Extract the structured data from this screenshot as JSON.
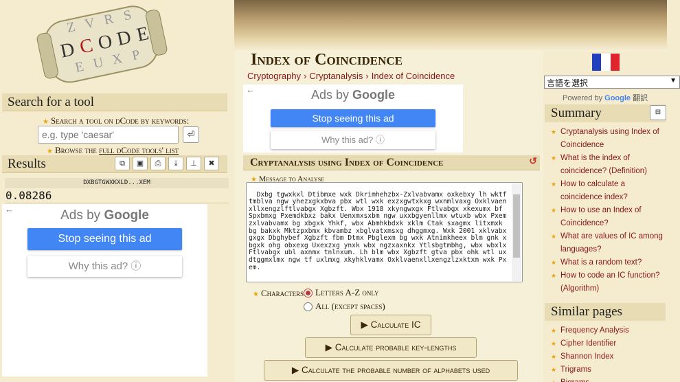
{
  "logo": {
    "letters_top": [
      "Z",
      "V",
      "R",
      "S"
    ],
    "letters_mid": [
      "D",
      "C",
      "O",
      "D",
      "E"
    ],
    "letters_bot": [
      "E",
      "U",
      "X",
      "P"
    ]
  },
  "left": {
    "search_title": "Search for a tool",
    "search_label": "Search a tool on dCode by keywords:",
    "search_placeholder": "e.g. type 'caesar'",
    "browse_prefix": "Browse the ",
    "browse_link": "full dCode tools' list",
    "results_title": "Results",
    "result_key": "DXBGTGWXKXLD...XEM",
    "result_value": "0.08286"
  },
  "ads": {
    "ads_by": "Ads by",
    "google": "Google",
    "stop": "Stop seeing this ad",
    "why": "Why this ad? ⓘ",
    "back": "←"
  },
  "center": {
    "page_title": "Index of Coincidence",
    "breadcrumbs": [
      "Cryptography",
      "Cryptanalysis",
      "Index of Coincidence"
    ],
    "panel_title": "Cryptanalysis using Index of Coincidence",
    "message_label": "Message to Analyse",
    "message_text": "Dxbg tgwxkxl Dtibmxe wxk Dkrimhehzbx-Zxlvabvamx oxkebxy lh wktftmblva ngw yhezxgkxbva pbx wtl wxk exzxgwtxkxg wxnmlvaxg Oxklvaenxllxengzlftlvabgx Xgbzft. Wbx 1918 xkyngwxgx Ftlvabgx xkexumx bf Spxbmxg Pxemdkbxz bakx Uenxmxsxbm ngw uxxbgyenllmx wtuxb wbx Pxemzxlvabvamx bg xbgxk Yhkf, wbx Abmhkbdxk xklm Ctak sxagmx litxmxk bg bakxk Mktzpxbmx kbvambz xbglvatxmsxg dhggmxg. Wxk 2001 xklvabxgxgx Dbghybef Xgbzft fbm Dtmx Pbglexm bg wxk Atnimkheex blm gnk xbgxk ohg obxexg Uxexzxg ynxk wbx ngzxaxnkx Ytlsbgtmbhg, wbx wbxlx Ftlvabgx ubl axnmx tnlnxum. Lh blm wbx Xgbzft gtva pbx ohk wtl uxdtggmxlmx ngw tf uxlmxg xkyhklvamx Oxklvaenxllxengzlzxktxm wxk Pxem.",
    "characters_label": "Characters",
    "radio_letters": "Letters A-Z only",
    "radio_all": "All (except spaces)",
    "btn_calc": "Calculate IC",
    "btn_keylen": "Calculate probable key-lengths",
    "btn_alpha": "Calculate the probable number of alphabets used"
  },
  "right": {
    "lang_select": "言語を選択",
    "powered_by": "Powered by",
    "powered_google": "Google",
    "powered_translate": "翻訳",
    "summary_title": "Summary",
    "summary_items": [
      "Cryptanalysis using Index of Coincidence",
      "What is the index of coincidence? (Definition)",
      "How to calculate a coincidence index?",
      "How to use an Index of Coincidence?",
      "What are values of IC among languages?",
      "What is a random text?",
      "How to code an IC function? (Algorithm)"
    ],
    "similar_title": "Similar pages",
    "similar_items": [
      "Frequency Analysis",
      "Cipher Identifier",
      "Shannon Index",
      "Trigrams",
      "Bigrams"
    ]
  },
  "colors": {
    "accent_red": "#8a1616",
    "star": "#e7a413",
    "google_blue": "#4285f4",
    "parchment": "#f5ecd0"
  }
}
